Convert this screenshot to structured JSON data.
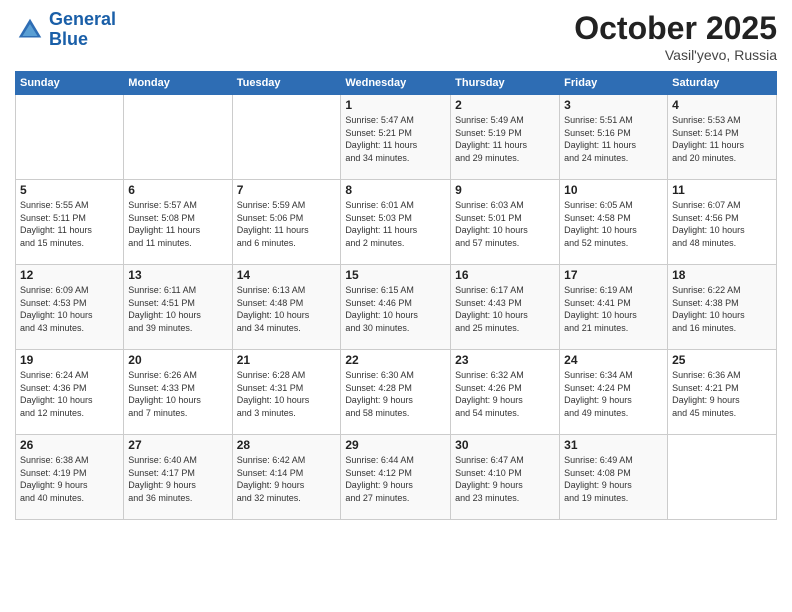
{
  "header": {
    "logo_line1": "General",
    "logo_line2": "Blue",
    "month": "October 2025",
    "location": "Vasil'yevo, Russia"
  },
  "weekdays": [
    "Sunday",
    "Monday",
    "Tuesday",
    "Wednesday",
    "Thursday",
    "Friday",
    "Saturday"
  ],
  "weeks": [
    [
      {
        "day": "",
        "info": ""
      },
      {
        "day": "",
        "info": ""
      },
      {
        "day": "",
        "info": ""
      },
      {
        "day": "1",
        "info": "Sunrise: 5:47 AM\nSunset: 5:21 PM\nDaylight: 11 hours\nand 34 minutes."
      },
      {
        "day": "2",
        "info": "Sunrise: 5:49 AM\nSunset: 5:19 PM\nDaylight: 11 hours\nand 29 minutes."
      },
      {
        "day": "3",
        "info": "Sunrise: 5:51 AM\nSunset: 5:16 PM\nDaylight: 11 hours\nand 24 minutes."
      },
      {
        "day": "4",
        "info": "Sunrise: 5:53 AM\nSunset: 5:14 PM\nDaylight: 11 hours\nand 20 minutes."
      }
    ],
    [
      {
        "day": "5",
        "info": "Sunrise: 5:55 AM\nSunset: 5:11 PM\nDaylight: 11 hours\nand 15 minutes."
      },
      {
        "day": "6",
        "info": "Sunrise: 5:57 AM\nSunset: 5:08 PM\nDaylight: 11 hours\nand 11 minutes."
      },
      {
        "day": "7",
        "info": "Sunrise: 5:59 AM\nSunset: 5:06 PM\nDaylight: 11 hours\nand 6 minutes."
      },
      {
        "day": "8",
        "info": "Sunrise: 6:01 AM\nSunset: 5:03 PM\nDaylight: 11 hours\nand 2 minutes."
      },
      {
        "day": "9",
        "info": "Sunrise: 6:03 AM\nSunset: 5:01 PM\nDaylight: 10 hours\nand 57 minutes."
      },
      {
        "day": "10",
        "info": "Sunrise: 6:05 AM\nSunset: 4:58 PM\nDaylight: 10 hours\nand 52 minutes."
      },
      {
        "day": "11",
        "info": "Sunrise: 6:07 AM\nSunset: 4:56 PM\nDaylight: 10 hours\nand 48 minutes."
      }
    ],
    [
      {
        "day": "12",
        "info": "Sunrise: 6:09 AM\nSunset: 4:53 PM\nDaylight: 10 hours\nand 43 minutes."
      },
      {
        "day": "13",
        "info": "Sunrise: 6:11 AM\nSunset: 4:51 PM\nDaylight: 10 hours\nand 39 minutes."
      },
      {
        "day": "14",
        "info": "Sunrise: 6:13 AM\nSunset: 4:48 PM\nDaylight: 10 hours\nand 34 minutes."
      },
      {
        "day": "15",
        "info": "Sunrise: 6:15 AM\nSunset: 4:46 PM\nDaylight: 10 hours\nand 30 minutes."
      },
      {
        "day": "16",
        "info": "Sunrise: 6:17 AM\nSunset: 4:43 PM\nDaylight: 10 hours\nand 25 minutes."
      },
      {
        "day": "17",
        "info": "Sunrise: 6:19 AM\nSunset: 4:41 PM\nDaylight: 10 hours\nand 21 minutes."
      },
      {
        "day": "18",
        "info": "Sunrise: 6:22 AM\nSunset: 4:38 PM\nDaylight: 10 hours\nand 16 minutes."
      }
    ],
    [
      {
        "day": "19",
        "info": "Sunrise: 6:24 AM\nSunset: 4:36 PM\nDaylight: 10 hours\nand 12 minutes."
      },
      {
        "day": "20",
        "info": "Sunrise: 6:26 AM\nSunset: 4:33 PM\nDaylight: 10 hours\nand 7 minutes."
      },
      {
        "day": "21",
        "info": "Sunrise: 6:28 AM\nSunset: 4:31 PM\nDaylight: 10 hours\nand 3 minutes."
      },
      {
        "day": "22",
        "info": "Sunrise: 6:30 AM\nSunset: 4:28 PM\nDaylight: 9 hours\nand 58 minutes."
      },
      {
        "day": "23",
        "info": "Sunrise: 6:32 AM\nSunset: 4:26 PM\nDaylight: 9 hours\nand 54 minutes."
      },
      {
        "day": "24",
        "info": "Sunrise: 6:34 AM\nSunset: 4:24 PM\nDaylight: 9 hours\nand 49 minutes."
      },
      {
        "day": "25",
        "info": "Sunrise: 6:36 AM\nSunset: 4:21 PM\nDaylight: 9 hours\nand 45 minutes."
      }
    ],
    [
      {
        "day": "26",
        "info": "Sunrise: 6:38 AM\nSunset: 4:19 PM\nDaylight: 9 hours\nand 40 minutes."
      },
      {
        "day": "27",
        "info": "Sunrise: 6:40 AM\nSunset: 4:17 PM\nDaylight: 9 hours\nand 36 minutes."
      },
      {
        "day": "28",
        "info": "Sunrise: 6:42 AM\nSunset: 4:14 PM\nDaylight: 9 hours\nand 32 minutes."
      },
      {
        "day": "29",
        "info": "Sunrise: 6:44 AM\nSunset: 4:12 PM\nDaylight: 9 hours\nand 27 minutes."
      },
      {
        "day": "30",
        "info": "Sunrise: 6:47 AM\nSunset: 4:10 PM\nDaylight: 9 hours\nand 23 minutes."
      },
      {
        "day": "31",
        "info": "Sunrise: 6:49 AM\nSunset: 4:08 PM\nDaylight: 9 hours\nand 19 minutes."
      },
      {
        "day": "",
        "info": ""
      }
    ]
  ]
}
